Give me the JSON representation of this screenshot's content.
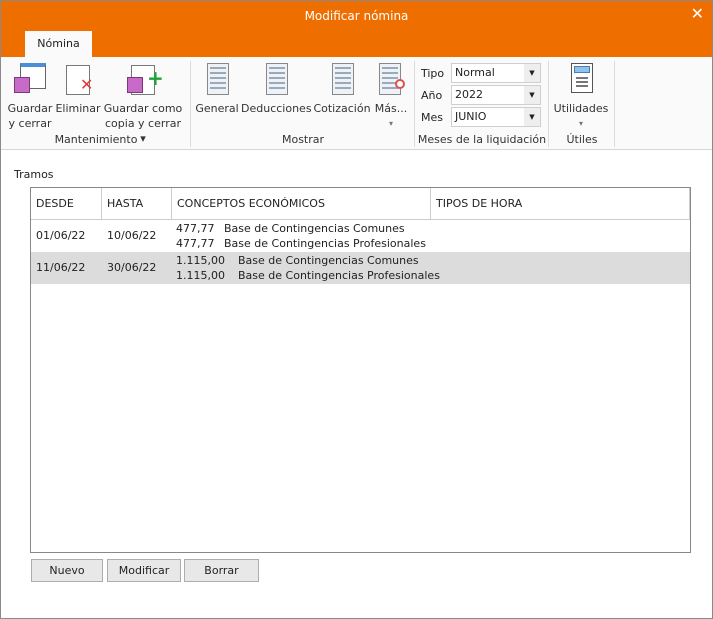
{
  "window": {
    "title": "Modificar nómina",
    "close": "✕"
  },
  "tabs": [
    {
      "label": "Nómina",
      "active": true
    }
  ],
  "ribbon": {
    "mantenimiento": {
      "label": "Mantenimiento",
      "buttons": [
        {
          "line1": "Guardar",
          "line2": "y cerrar"
        },
        {
          "line1": "Eliminar"
        },
        {
          "line1": "Guardar como",
          "line2": "copia y cerrar ▾"
        }
      ]
    },
    "mostrar": {
      "label": "Mostrar",
      "buttons": [
        {
          "line1": "General"
        },
        {
          "line1": "Deducciones"
        },
        {
          "line1": "Cotización"
        },
        {
          "line1": "Más...",
          "line2": "▾"
        }
      ]
    },
    "meses": {
      "label": "Meses de la liquidación",
      "tipo_label": "Tipo",
      "tipo": "Normal",
      "anio_label": "Año",
      "anio": "2022",
      "mes_label": "Mes",
      "mes": "JUNIO"
    },
    "utiles": {
      "label": "Útiles",
      "button": "Utilidades",
      "arrow": "▾"
    }
  },
  "tramos": {
    "label": "Tramos",
    "columns": [
      "DESDE",
      "HASTA",
      "CONCEPTOS ECONÓMICOS",
      "TIPOS DE HORA"
    ],
    "rows": [
      {
        "desde": "01/06/22",
        "hasta": "10/06/22",
        "conceptos": [
          {
            "importe": "477,77",
            "nombre": "Base de Contingencias Comunes"
          },
          {
            "importe": "477,77",
            "nombre": "Base de Contingencias Profesionales"
          }
        ],
        "tipos": "",
        "selected": false
      },
      {
        "desde": "11/06/22",
        "hasta": "30/06/22",
        "conceptos": [
          {
            "importe": "1.115,00",
            "nombre": "Base de Contingencias Comunes"
          },
          {
            "importe": "1.115,00",
            "nombre": "Base de Contingencias Profesionales"
          }
        ],
        "tipos": "",
        "selected": true
      }
    ]
  },
  "buttons": {
    "nuevo": "Nuevo",
    "modificar": "Modificar",
    "borrar": "Borrar"
  },
  "colors": {
    "titlebar": "#ee6e00",
    "selected_row": "#dcdcdc"
  }
}
